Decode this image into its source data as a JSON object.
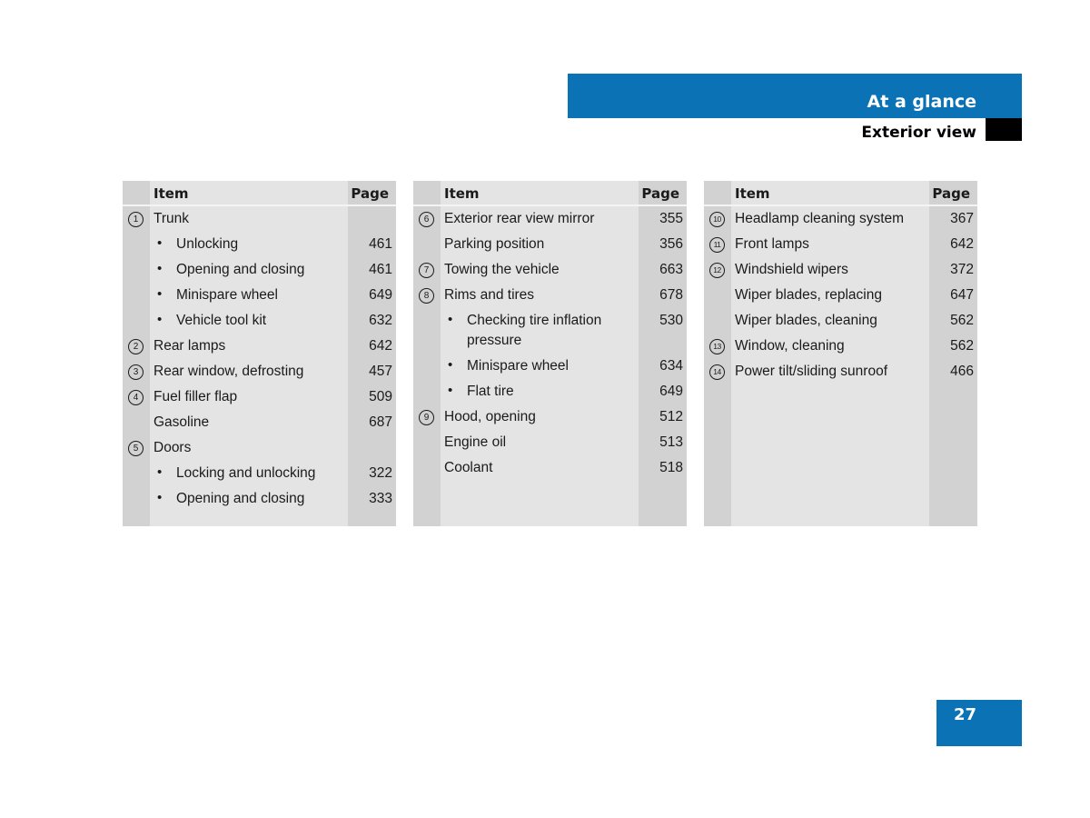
{
  "header": {
    "chapter": "At a glance",
    "section": "Exterior view",
    "accent_color": "#0b72b5"
  },
  "tables": [
    {
      "col_item": "Item",
      "col_page": "Page",
      "rows": [
        {
          "num": "1",
          "label": "Trunk",
          "page": "",
          "bullet": false
        },
        {
          "num": "",
          "label": "Unlocking",
          "page": "461",
          "bullet": true
        },
        {
          "num": "",
          "label": "Opening and closing",
          "page": "461",
          "bullet": true
        },
        {
          "num": "",
          "label": "Minispare wheel",
          "page": "649",
          "bullet": true
        },
        {
          "num": "",
          "label": "Vehicle tool kit",
          "page": "632",
          "bullet": true
        },
        {
          "num": "2",
          "label": "Rear lamps",
          "page": "642",
          "bullet": false
        },
        {
          "num": "3",
          "label": "Rear window, defrosting",
          "page": "457",
          "bullet": false
        },
        {
          "num": "4",
          "label": "Fuel filler flap",
          "page": "509",
          "bullet": false
        },
        {
          "num": "",
          "label": "Gasoline",
          "page": "687",
          "bullet": false
        },
        {
          "num": "5",
          "label": "Doors",
          "page": "",
          "bullet": false
        },
        {
          "num": "",
          "label": "Locking and unlocking",
          "page": "322",
          "bullet": true
        },
        {
          "num": "",
          "label": "Opening and closing",
          "page": "333",
          "bullet": true
        }
      ]
    },
    {
      "col_item": "Item",
      "col_page": "Page",
      "rows": [
        {
          "num": "6",
          "label": "Exterior rear view mirror",
          "page": "355",
          "bullet": false
        },
        {
          "num": "",
          "label": "Parking position",
          "page": "356",
          "bullet": false
        },
        {
          "num": "7",
          "label": "Towing the vehicle",
          "page": "663",
          "bullet": false
        },
        {
          "num": "8",
          "label": "Rims and tires",
          "page": "678",
          "bullet": false
        },
        {
          "num": "",
          "label": "Checking tire inflation pressure",
          "page": "530",
          "bullet": true
        },
        {
          "num": "",
          "label": "Minispare wheel",
          "page": "634",
          "bullet": true
        },
        {
          "num": "",
          "label": "Flat tire",
          "page": "649",
          "bullet": true
        },
        {
          "num": "9",
          "label": "Hood, opening",
          "page": "512",
          "bullet": false
        },
        {
          "num": "",
          "label": "Engine oil",
          "page": "513",
          "bullet": false
        },
        {
          "num": "",
          "label": "Coolant",
          "page": "518",
          "bullet": false
        }
      ]
    },
    {
      "col_item": "Item",
      "col_page": "Page",
      "rows": [
        {
          "num": "10",
          "label": "Headlamp cleaning system",
          "page": "367",
          "bullet": false
        },
        {
          "num": "11",
          "label": "Front lamps",
          "page": "642",
          "bullet": false
        },
        {
          "num": "12",
          "label": "Windshield wipers",
          "page": "372",
          "bullet": false
        },
        {
          "num": "",
          "label": "Wiper blades, replacing",
          "page": "647",
          "bullet": false
        },
        {
          "num": "",
          "label": "Wiper blades, cleaning",
          "page": "562",
          "bullet": false
        },
        {
          "num": "13",
          "label": "Window, cleaning",
          "page": "562",
          "bullet": false
        },
        {
          "num": "14",
          "label": "Power tilt/sliding sunroof",
          "page": "466",
          "bullet": false
        }
      ]
    }
  ],
  "footer": {
    "page_number": "27"
  }
}
